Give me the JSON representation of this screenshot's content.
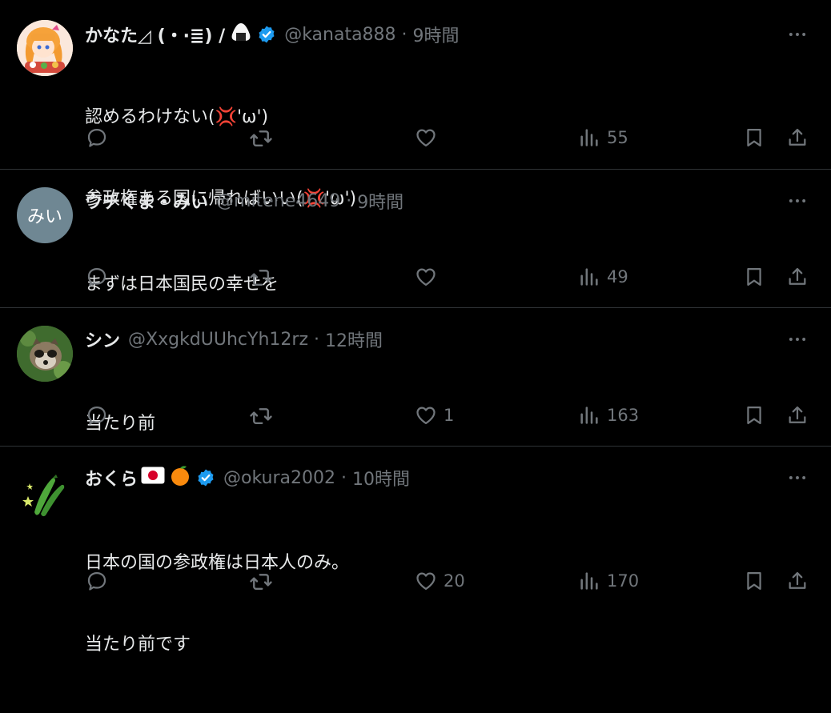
{
  "colors": {
    "background": "#000000",
    "text": "#e7e9ea",
    "muted": "#71767b",
    "verified": "#1d9bf0",
    "separator": "#2f3336"
  },
  "tweets": [
    {
      "name": "かなた◿ (・·≣) /",
      "name_emojis": [
        "onigiri-emoji"
      ],
      "verified": true,
      "handle": "@kanata888",
      "dot": "·",
      "time": "9時間",
      "lines": [
        "認めるわけない(💢'ω')",
        "参政権ある国に帰ればいい(💢'ω')"
      ],
      "replies": "",
      "retweets": "",
      "likes": "",
      "views": "55",
      "avatar": "anime-girl-avatar"
    },
    {
      "name": "ウチくま・みい",
      "verified": false,
      "handle": "@mitene4649",
      "dot": "·",
      "time": "9時間",
      "lines": [
        "まずは日本国民の幸せを"
      ],
      "replies": "",
      "retweets": "",
      "likes": "",
      "views": "49",
      "avatar_text": "みい"
    },
    {
      "name": "シン",
      "verified": false,
      "handle": "@XxgkdUUhcYh12rz",
      "dot": "·",
      "time": "12時間",
      "lines": [
        "当たり前"
      ],
      "replies": "",
      "retweets": "",
      "likes": "1",
      "views": "163",
      "avatar": "raccoon-dog-avatar"
    },
    {
      "name": "おくら",
      "name_emojis": [
        "japan-flag-emoji",
        "tangerine-emoji"
      ],
      "verified": true,
      "handle": "@okura2002",
      "dot": "·",
      "time": "10時間",
      "lines": [
        "日本の国の参政権は日本人のみ。",
        "当たり前です"
      ],
      "replies": "",
      "retweets": "",
      "likes": "20",
      "views": "170",
      "avatar": "okra-avatar"
    }
  ],
  "icons": {
    "reply": "reply-icon",
    "retweet": "retweet-icon",
    "like": "heart-icon",
    "views": "views-chart-icon",
    "bookmark": "bookmark-icon",
    "share": "share-icon",
    "more": "more-dots-icon",
    "verified": "verified-badge-icon"
  }
}
